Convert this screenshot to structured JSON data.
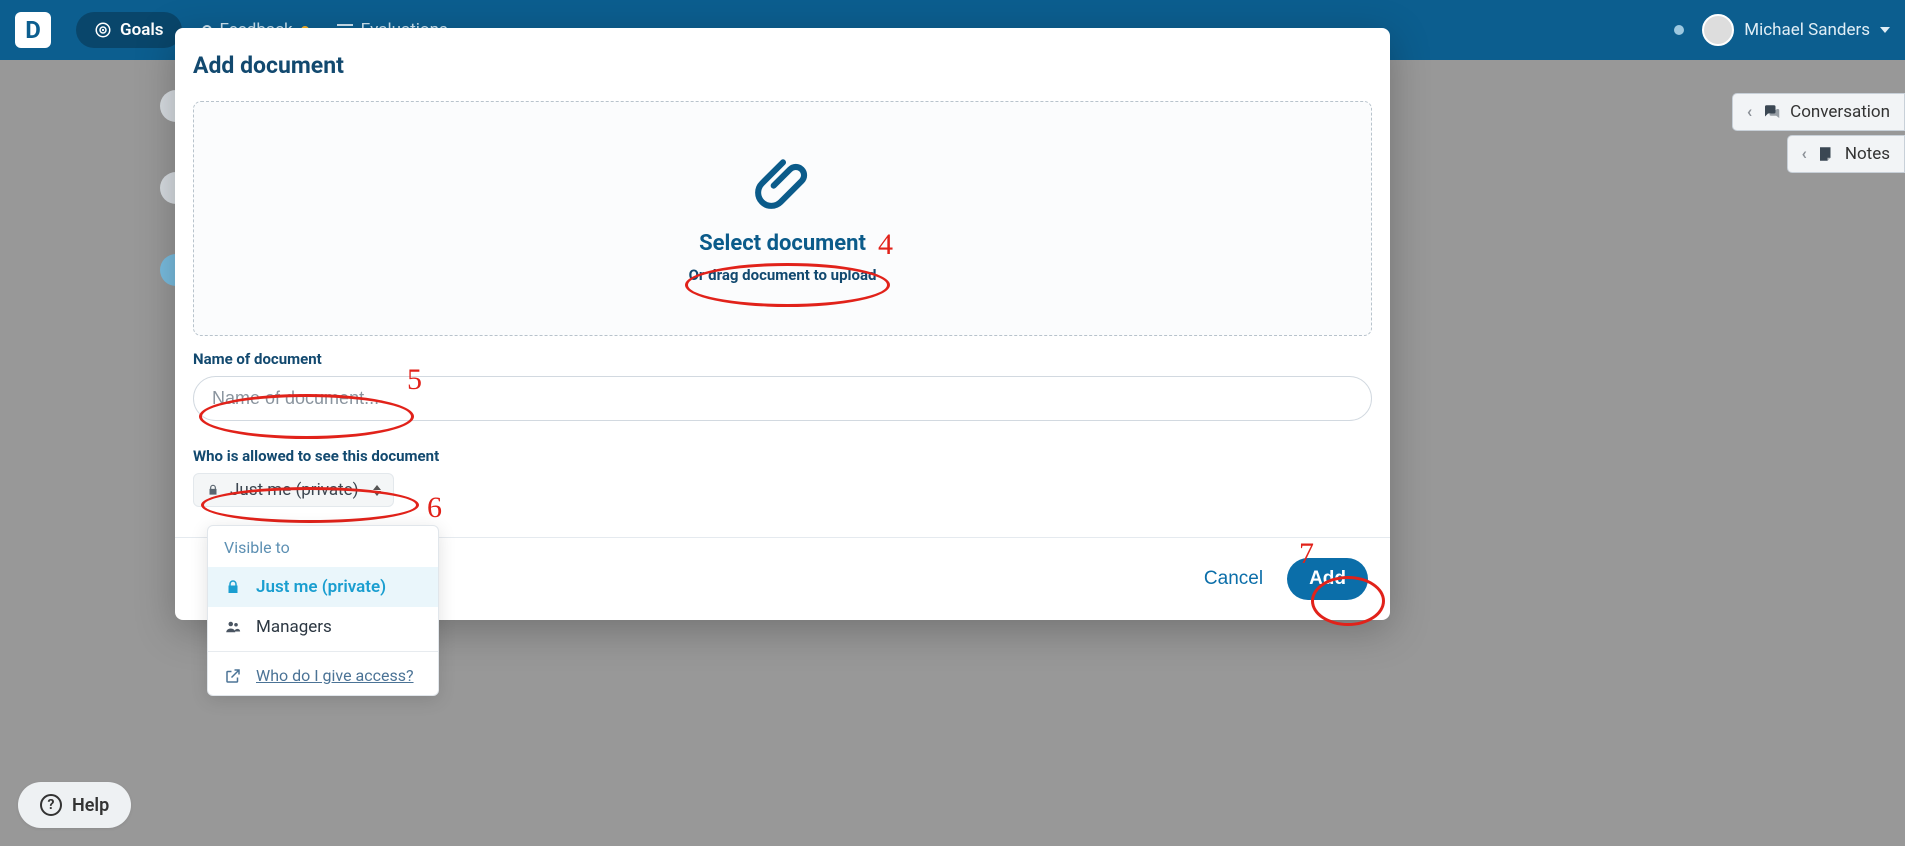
{
  "topbar": {
    "logo_letter": "D",
    "goals_label": "Goals",
    "feedback_label": "Feedback",
    "evaluations_label": "Evaluations",
    "user_name": "Michael Sanders"
  },
  "side_panels": {
    "conversation": "Conversation",
    "notes": "Notes"
  },
  "help": {
    "label": "Help"
  },
  "modal": {
    "title": "Add document",
    "select_document": "Select document",
    "drag_text": "Or drag document to upload",
    "name_label": "Name of document",
    "name_placeholder": "Name of document...",
    "visibility_label": "Who is allowed to see this document",
    "visibility_selected": "Just me (private)",
    "cancel": "Cancel",
    "add": "Add"
  },
  "dropdown": {
    "header": "Visible to",
    "items": [
      {
        "label": "Just me (private)",
        "icon": "lock",
        "active": true
      },
      {
        "label": "Managers",
        "icon": "users",
        "active": false
      }
    ],
    "help_link": "Who do I give access?"
  },
  "annotations": {
    "n4": "4",
    "n5": "5",
    "n6": "6",
    "n7": "7"
  }
}
